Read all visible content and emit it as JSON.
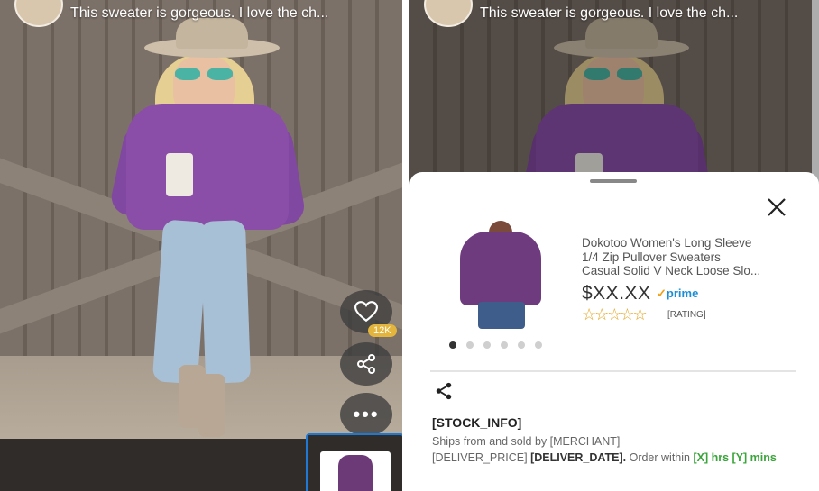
{
  "feed": {
    "caption": "This sweater is gorgeous. I love the ch...",
    "like_count": "12K",
    "more_glyph": "•••"
  },
  "product": {
    "title_lines": [
      "Dokotoo Women's Long Sleeve",
      "1/4 Zip Pullover Sweaters",
      "Casual Solid V Neck Loose Slo..."
    ],
    "price": "$XX.XX",
    "prime_label": "prime",
    "rating_label": "[RATING]",
    "stars": "☆☆☆☆☆",
    "carousel_count": 6,
    "carousel_active": 0,
    "stock_info": "[STOCK_INFO]",
    "ships_from": "Ships from and sold by [MERCHANT]",
    "delivery": {
      "price": "[DELIVER_PRICE]",
      "date": "[DELIVER_DATE].",
      "order_within": "Order within",
      "time": "[X] hrs [Y] mins"
    }
  },
  "icons": {
    "like": "heart-icon",
    "share": "share-icon",
    "more": "more-icon",
    "close": "close-icon"
  },
  "colors": {
    "prime_blue": "#1a8fd6",
    "star_gold": "#e3a31e",
    "delivery_green": "#3aa53a",
    "thumb_border": "#1f78d1",
    "badge_yellow": "#e3b53c"
  }
}
